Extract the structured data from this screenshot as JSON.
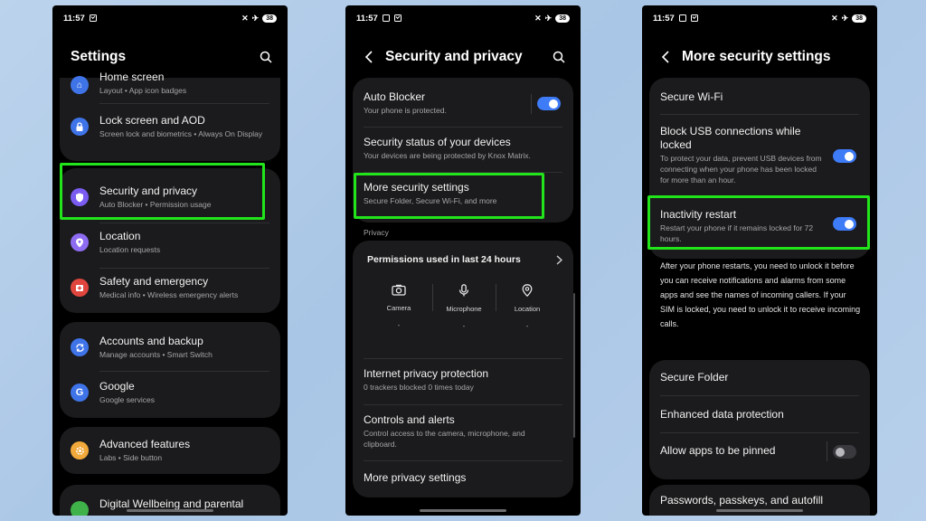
{
  "phone1": {
    "status": {
      "time": "11:57",
      "battery": "38"
    },
    "title": "Settings",
    "groups": [
      {
        "items": [
          {
            "title": "Home screen",
            "subtitle": "Layout  •  App icon badges",
            "icon": "home-icon",
            "color": "#3f74e8"
          },
          {
            "title": "Lock screen and AOD",
            "subtitle": "Screen lock and biometrics  •  Always On Display",
            "icon": "lock-icon",
            "color": "#3f74e8"
          }
        ]
      },
      {
        "items": [
          {
            "title": "Security and privacy",
            "subtitle": "Auto Blocker  •  Permission usage",
            "icon": "shield-icon",
            "color": "#7a5cf0"
          },
          {
            "title": "Location",
            "subtitle": "Location requests",
            "icon": "location-icon",
            "color": "#8e6cf2"
          },
          {
            "title": "Safety and emergency",
            "subtitle": "Medical info  •  Wireless emergency alerts",
            "icon": "emergency-icon",
            "color": "#e0463e"
          }
        ]
      },
      {
        "items": [
          {
            "title": "Accounts and backup",
            "subtitle": "Manage accounts  •  Smart Switch",
            "icon": "sync-icon",
            "color": "#3f74e8"
          },
          {
            "title": "Google",
            "subtitle": "Google services",
            "icon": "google-icon",
            "color": "#3f74e8"
          }
        ]
      },
      {
        "items": [
          {
            "title": "Advanced features",
            "subtitle": "Labs  •  Side button",
            "icon": "gear-star-icon",
            "color": "#f0a93a"
          }
        ]
      },
      {
        "items": [
          {
            "title": "Digital Wellbeing and parental",
            "subtitle": "",
            "icon": "wellbeing-icon",
            "color": "#3fb24a"
          }
        ]
      }
    ]
  },
  "phone2": {
    "status": {
      "time": "11:57",
      "battery": "38"
    },
    "title": "Security and privacy",
    "auto_blocker": {
      "title": "Auto Blocker",
      "subtitle": "Your phone is protected.",
      "toggle_on": true
    },
    "security_status": {
      "title": "Security status of your devices",
      "subtitle": "Your devices are being protected by Knox Matrix."
    },
    "more_security": {
      "title": "More security settings",
      "subtitle": "Secure Folder, Secure Wi-Fi, and more"
    },
    "privacy_label": "Privacy",
    "permissions": {
      "title": "Permissions used in last 24 hours",
      "items": [
        {
          "label": "Camera",
          "icon": "camera-icon",
          "value": "-"
        },
        {
          "label": "Microphone",
          "icon": "microphone-icon",
          "value": "-"
        },
        {
          "label": "Location",
          "icon": "location-pin-icon",
          "value": "-"
        }
      ]
    },
    "internet_privacy": {
      "title": "Internet privacy protection",
      "subtitle": "0 trackers blocked 0 times today"
    },
    "controls": {
      "title": "Controls and alerts",
      "subtitle": "Control access to the camera, microphone, and clipboard."
    },
    "more_privacy": {
      "title": "More privacy settings"
    }
  },
  "phone3": {
    "status": {
      "time": "11:57",
      "battery": "38"
    },
    "title": "More security settings",
    "secure_wifi": "Secure Wi-Fi",
    "block_usb": {
      "title": "Block USB connections while locked",
      "subtitle": "To protect your data, prevent USB devices from connecting when your phone has been locked for more than an hour.",
      "toggle_on": true
    },
    "inactivity": {
      "title": "Inactivity restart",
      "subtitle": "Restart your phone if it remains locked for 72 hours.",
      "toggle_on": true
    },
    "description": "After your phone restarts, you need to unlock it before you can receive notifications and alarms from some apps and see the names of incoming callers. If your SIM is locked, you need to unlock it to receive incoming calls.",
    "secure_folder": "Secure Folder",
    "enhanced_data": "Enhanced data protection",
    "allow_pinned": {
      "title": "Allow apps to be pinned",
      "toggle_on": false
    },
    "passwords": "Passwords, passkeys, and autofill"
  },
  "colors": {
    "highlight": "#22e41b",
    "toggle_on": "#3e7bf7",
    "card": "#1b1b1d"
  }
}
